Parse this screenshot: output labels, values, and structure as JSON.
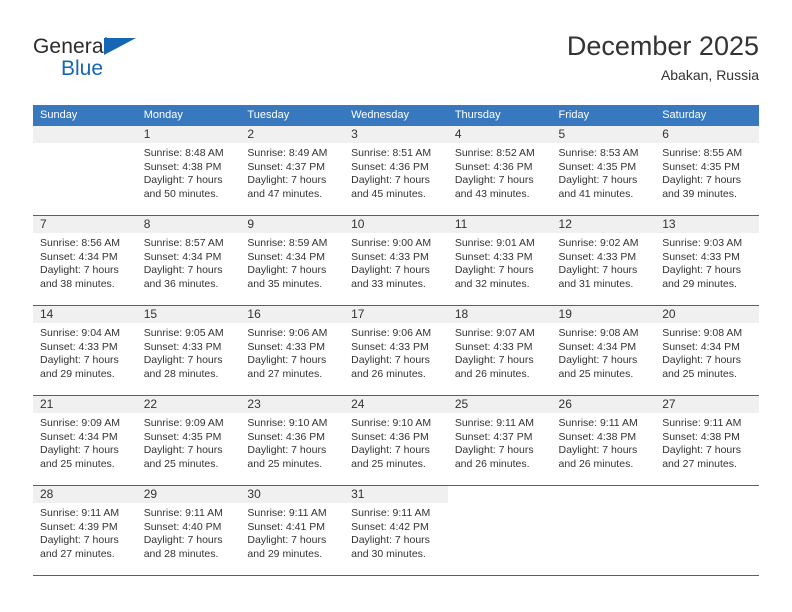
{
  "brand": {
    "name_top": "General",
    "name_bottom": "Blue",
    "triangle_icon": "blue-triangle-icon",
    "accent_color": "#1567b3"
  },
  "header": {
    "title": "December 2025",
    "subtitle": "Abakan, Russia"
  },
  "theme": {
    "header_row_bg": "#3778bf",
    "week_divider": "#2f6ca5",
    "daynum_band_bg": "#f0f0f0",
    "text": "#333333"
  },
  "calendar": {
    "weekday_headers": [
      "Sunday",
      "Monday",
      "Tuesday",
      "Wednesday",
      "Thursday",
      "Friday",
      "Saturday"
    ],
    "weeks": [
      [
        {
          "day": "",
          "sunrise": "",
          "sunset": "",
          "daylight_line1": "",
          "daylight_line2": ""
        },
        {
          "day": "1",
          "sunrise": "Sunrise: 8:48 AM",
          "sunset": "Sunset: 4:38 PM",
          "daylight_line1": "Daylight: 7 hours",
          "daylight_line2": "and 50 minutes."
        },
        {
          "day": "2",
          "sunrise": "Sunrise: 8:49 AM",
          "sunset": "Sunset: 4:37 PM",
          "daylight_line1": "Daylight: 7 hours",
          "daylight_line2": "and 47 minutes."
        },
        {
          "day": "3",
          "sunrise": "Sunrise: 8:51 AM",
          "sunset": "Sunset: 4:36 PM",
          "daylight_line1": "Daylight: 7 hours",
          "daylight_line2": "and 45 minutes."
        },
        {
          "day": "4",
          "sunrise": "Sunrise: 8:52 AM",
          "sunset": "Sunset: 4:36 PM",
          "daylight_line1": "Daylight: 7 hours",
          "daylight_line2": "and 43 minutes."
        },
        {
          "day": "5",
          "sunrise": "Sunrise: 8:53 AM",
          "sunset": "Sunset: 4:35 PM",
          "daylight_line1": "Daylight: 7 hours",
          "daylight_line2": "and 41 minutes."
        },
        {
          "day": "6",
          "sunrise": "Sunrise: 8:55 AM",
          "sunset": "Sunset: 4:35 PM",
          "daylight_line1": "Daylight: 7 hours",
          "daylight_line2": "and 39 minutes."
        }
      ],
      [
        {
          "day": "7",
          "sunrise": "Sunrise: 8:56 AM",
          "sunset": "Sunset: 4:34 PM",
          "daylight_line1": "Daylight: 7 hours",
          "daylight_line2": "and 38 minutes."
        },
        {
          "day": "8",
          "sunrise": "Sunrise: 8:57 AM",
          "sunset": "Sunset: 4:34 PM",
          "daylight_line1": "Daylight: 7 hours",
          "daylight_line2": "and 36 minutes."
        },
        {
          "day": "9",
          "sunrise": "Sunrise: 8:59 AM",
          "sunset": "Sunset: 4:34 PM",
          "daylight_line1": "Daylight: 7 hours",
          "daylight_line2": "and 35 minutes."
        },
        {
          "day": "10",
          "sunrise": "Sunrise: 9:00 AM",
          "sunset": "Sunset: 4:33 PM",
          "daylight_line1": "Daylight: 7 hours",
          "daylight_line2": "and 33 minutes."
        },
        {
          "day": "11",
          "sunrise": "Sunrise: 9:01 AM",
          "sunset": "Sunset: 4:33 PM",
          "daylight_line1": "Daylight: 7 hours",
          "daylight_line2": "and 32 minutes."
        },
        {
          "day": "12",
          "sunrise": "Sunrise: 9:02 AM",
          "sunset": "Sunset: 4:33 PM",
          "daylight_line1": "Daylight: 7 hours",
          "daylight_line2": "and 31 minutes."
        },
        {
          "day": "13",
          "sunrise": "Sunrise: 9:03 AM",
          "sunset": "Sunset: 4:33 PM",
          "daylight_line1": "Daylight: 7 hours",
          "daylight_line2": "and 29 minutes."
        }
      ],
      [
        {
          "day": "14",
          "sunrise": "Sunrise: 9:04 AM",
          "sunset": "Sunset: 4:33 PM",
          "daylight_line1": "Daylight: 7 hours",
          "daylight_line2": "and 29 minutes."
        },
        {
          "day": "15",
          "sunrise": "Sunrise: 9:05 AM",
          "sunset": "Sunset: 4:33 PM",
          "daylight_line1": "Daylight: 7 hours",
          "daylight_line2": "and 28 minutes."
        },
        {
          "day": "16",
          "sunrise": "Sunrise: 9:06 AM",
          "sunset": "Sunset: 4:33 PM",
          "daylight_line1": "Daylight: 7 hours",
          "daylight_line2": "and 27 minutes."
        },
        {
          "day": "17",
          "sunrise": "Sunrise: 9:06 AM",
          "sunset": "Sunset: 4:33 PM",
          "daylight_line1": "Daylight: 7 hours",
          "daylight_line2": "and 26 minutes."
        },
        {
          "day": "18",
          "sunrise": "Sunrise: 9:07 AM",
          "sunset": "Sunset: 4:33 PM",
          "daylight_line1": "Daylight: 7 hours",
          "daylight_line2": "and 26 minutes."
        },
        {
          "day": "19",
          "sunrise": "Sunrise: 9:08 AM",
          "sunset": "Sunset: 4:34 PM",
          "daylight_line1": "Daylight: 7 hours",
          "daylight_line2": "and 25 minutes."
        },
        {
          "day": "20",
          "sunrise": "Sunrise: 9:08 AM",
          "sunset": "Sunset: 4:34 PM",
          "daylight_line1": "Daylight: 7 hours",
          "daylight_line2": "and 25 minutes."
        }
      ],
      [
        {
          "day": "21",
          "sunrise": "Sunrise: 9:09 AM",
          "sunset": "Sunset: 4:34 PM",
          "daylight_line1": "Daylight: 7 hours",
          "daylight_line2": "and 25 minutes."
        },
        {
          "day": "22",
          "sunrise": "Sunrise: 9:09 AM",
          "sunset": "Sunset: 4:35 PM",
          "daylight_line1": "Daylight: 7 hours",
          "daylight_line2": "and 25 minutes."
        },
        {
          "day": "23",
          "sunrise": "Sunrise: 9:10 AM",
          "sunset": "Sunset: 4:36 PM",
          "daylight_line1": "Daylight: 7 hours",
          "daylight_line2": "and 25 minutes."
        },
        {
          "day": "24",
          "sunrise": "Sunrise: 9:10 AM",
          "sunset": "Sunset: 4:36 PM",
          "daylight_line1": "Daylight: 7 hours",
          "daylight_line2": "and 25 minutes."
        },
        {
          "day": "25",
          "sunrise": "Sunrise: 9:11 AM",
          "sunset": "Sunset: 4:37 PM",
          "daylight_line1": "Daylight: 7 hours",
          "daylight_line2": "and 26 minutes."
        },
        {
          "day": "26",
          "sunrise": "Sunrise: 9:11 AM",
          "sunset": "Sunset: 4:38 PM",
          "daylight_line1": "Daylight: 7 hours",
          "daylight_line2": "and 26 minutes."
        },
        {
          "day": "27",
          "sunrise": "Sunrise: 9:11 AM",
          "sunset": "Sunset: 4:38 PM",
          "daylight_line1": "Daylight: 7 hours",
          "daylight_line2": "and 27 minutes."
        }
      ],
      [
        {
          "day": "28",
          "sunrise": "Sunrise: 9:11 AM",
          "sunset": "Sunset: 4:39 PM",
          "daylight_line1": "Daylight: 7 hours",
          "daylight_line2": "and 27 minutes."
        },
        {
          "day": "29",
          "sunrise": "Sunrise: 9:11 AM",
          "sunset": "Sunset: 4:40 PM",
          "daylight_line1": "Daylight: 7 hours",
          "daylight_line2": "and 28 minutes."
        },
        {
          "day": "30",
          "sunrise": "Sunrise: 9:11 AM",
          "sunset": "Sunset: 4:41 PM",
          "daylight_line1": "Daylight: 7 hours",
          "daylight_line2": "and 29 minutes."
        },
        {
          "day": "31",
          "sunrise": "Sunrise: 9:11 AM",
          "sunset": "Sunset: 4:42 PM",
          "daylight_line1": "Daylight: 7 hours",
          "daylight_line2": "and 30 minutes."
        },
        {
          "day": "",
          "sunrise": "",
          "sunset": "",
          "daylight_line1": "",
          "daylight_line2": ""
        },
        {
          "day": "",
          "sunrise": "",
          "sunset": "",
          "daylight_line1": "",
          "daylight_line2": ""
        },
        {
          "day": "",
          "sunrise": "",
          "sunset": "",
          "daylight_line1": "",
          "daylight_line2": ""
        }
      ]
    ]
  }
}
